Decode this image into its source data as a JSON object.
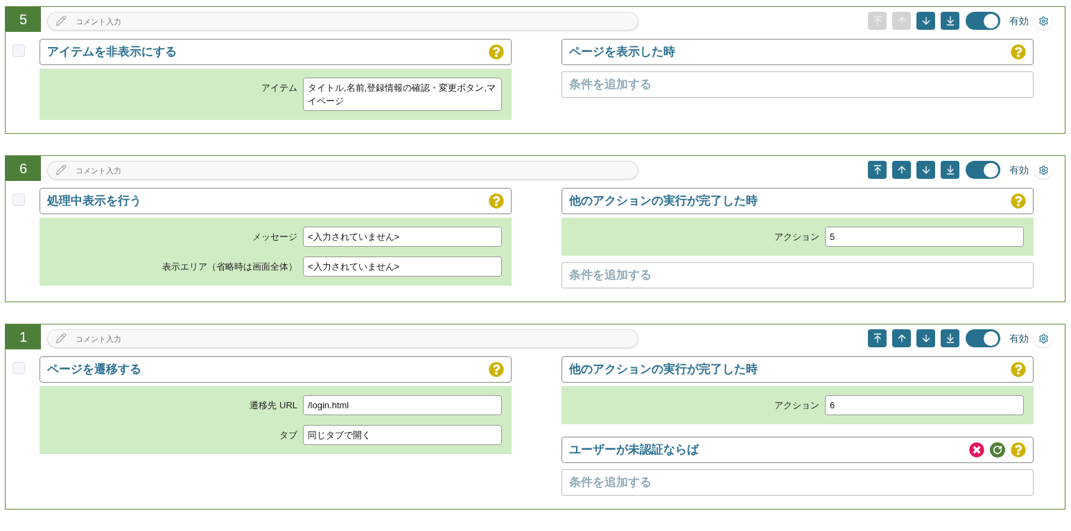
{
  "rules": [
    {
      "number": "5",
      "comment_placeholder": "コメント入力",
      "checked": false,
      "move_buttons": [
        {
          "kind": "top",
          "disabled": true
        },
        {
          "kind": "up",
          "disabled": true
        },
        {
          "kind": "down",
          "disabled": false
        },
        {
          "kind": "bottom",
          "disabled": false
        }
      ],
      "enabled": true,
      "enabled_label": "有効",
      "action": {
        "title": "アイテムを非表示にする",
        "params": [
          {
            "label": "アイテム",
            "value": "タイトル,名前,登録情報の確認・変更ボタン,マイページ"
          }
        ]
      },
      "conditions": [
        {
          "title": "ページを表示した時",
          "removable": false
        }
      ],
      "add_condition": "条件を追加する"
    },
    {
      "number": "6",
      "comment_placeholder": "コメント入力",
      "checked": false,
      "move_buttons": [
        {
          "kind": "top",
          "disabled": false
        },
        {
          "kind": "up",
          "disabled": false
        },
        {
          "kind": "down",
          "disabled": false
        },
        {
          "kind": "bottom",
          "disabled": false
        }
      ],
      "enabled": true,
      "enabled_label": "有効",
      "action": {
        "title": "処理中表示を行う",
        "params": [
          {
            "label": "メッセージ",
            "value": "<入力されていません>"
          },
          {
            "label": "表示エリア（省略時は画面全体）",
            "value": "<入力されていません>"
          }
        ]
      },
      "conditions": [
        {
          "title": "他のアクションの実行が完了した時",
          "removable": false,
          "params": [
            {
              "label": "アクション",
              "value": "5"
            }
          ]
        }
      ],
      "add_condition": "条件を追加する"
    },
    {
      "number": "1",
      "comment_placeholder": "コメント入力",
      "checked": false,
      "move_buttons": [
        {
          "kind": "top",
          "disabled": false
        },
        {
          "kind": "up",
          "disabled": false
        },
        {
          "kind": "down",
          "disabled": false
        },
        {
          "kind": "bottom",
          "disabled": false
        }
      ],
      "enabled": true,
      "enabled_label": "有効",
      "action": {
        "title": "ページを遷移する",
        "params": [
          {
            "label": "遷移先 URL",
            "value": "/login.html"
          },
          {
            "label": "タブ",
            "value": "同じタブで開く"
          }
        ]
      },
      "conditions": [
        {
          "title": "他のアクションの実行が完了した時",
          "removable": false,
          "params": [
            {
              "label": "アクション",
              "value": "6"
            }
          ]
        },
        {
          "title": "ユーザーが未認証ならば",
          "removable": true
        }
      ],
      "add_condition": "条件を追加する"
    }
  ]
}
